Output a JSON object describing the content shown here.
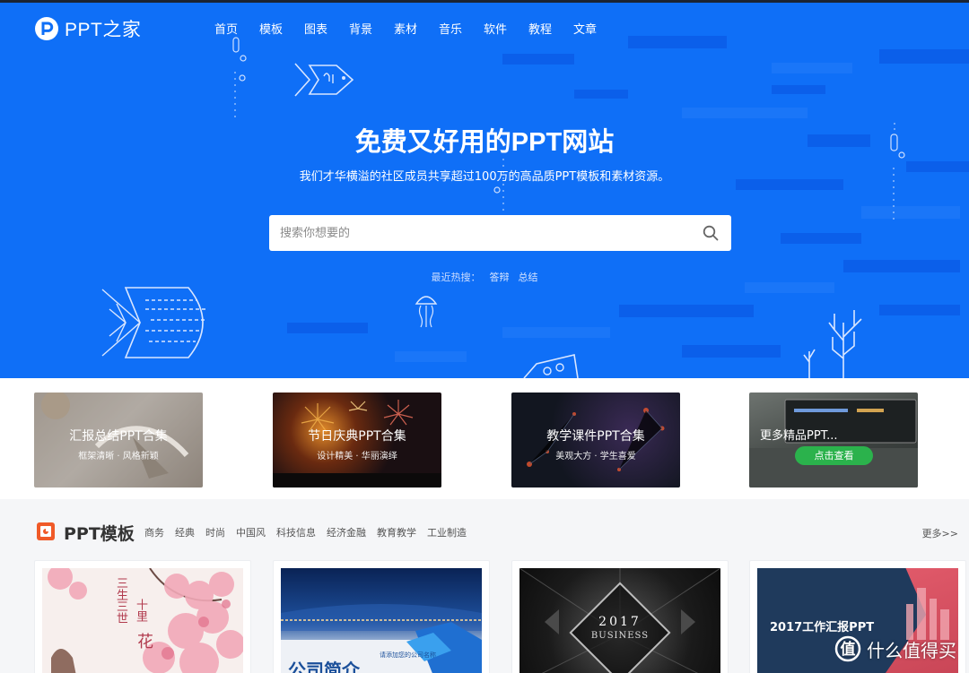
{
  "brand": {
    "logo_text": "PPT之家"
  },
  "nav": {
    "items": [
      "首页",
      "模板",
      "图表",
      "背景",
      "素材",
      "音乐",
      "软件",
      "教程",
      "文章"
    ]
  },
  "hero": {
    "title": "免费又好用的PPT网站",
    "subtitle": "我们才华横溢的社区成员共享超过100万的高品质PPT模板和素材资源。",
    "background_color": "#0f6ff7"
  },
  "search": {
    "placeholder": "搜索你想要的",
    "value": ""
  },
  "hot_search": {
    "label": "最近热搜：",
    "keywords": [
      "答辩",
      "总结"
    ]
  },
  "categories": [
    {
      "title": "汇报总结PPT合集",
      "subtitle": "框架清晰 · 风格新颖"
    },
    {
      "title": "节日庆典PPT合集",
      "subtitle": "设计精美 · 华丽演绎"
    },
    {
      "title": "教学课件PPT合集",
      "subtitle": "美观大方 · 学生喜爱"
    },
    {
      "title": "更多精品PPT...",
      "button_label": "点击查看",
      "button_color": "#2bb24c"
    }
  ],
  "templates_section": {
    "title": "PPT模板",
    "tags": [
      "商务",
      "经典",
      "时尚",
      "中国风",
      "科技信息",
      "经济金融",
      "教育教学",
      "工业制造"
    ],
    "more_label": "更多>>",
    "accent_color": "#f05a28"
  },
  "templates": [
    {
      "texts": [
        "三生三世",
        "十里",
        "花"
      ]
    },
    {
      "title": "公司简介",
      "subtitle": "请添加您的公司名称"
    },
    {
      "year": "2017",
      "word": "BUSINESS"
    },
    {
      "title": "2017工作汇报PPT"
    }
  ],
  "watermark": {
    "text": "什么值得买"
  }
}
